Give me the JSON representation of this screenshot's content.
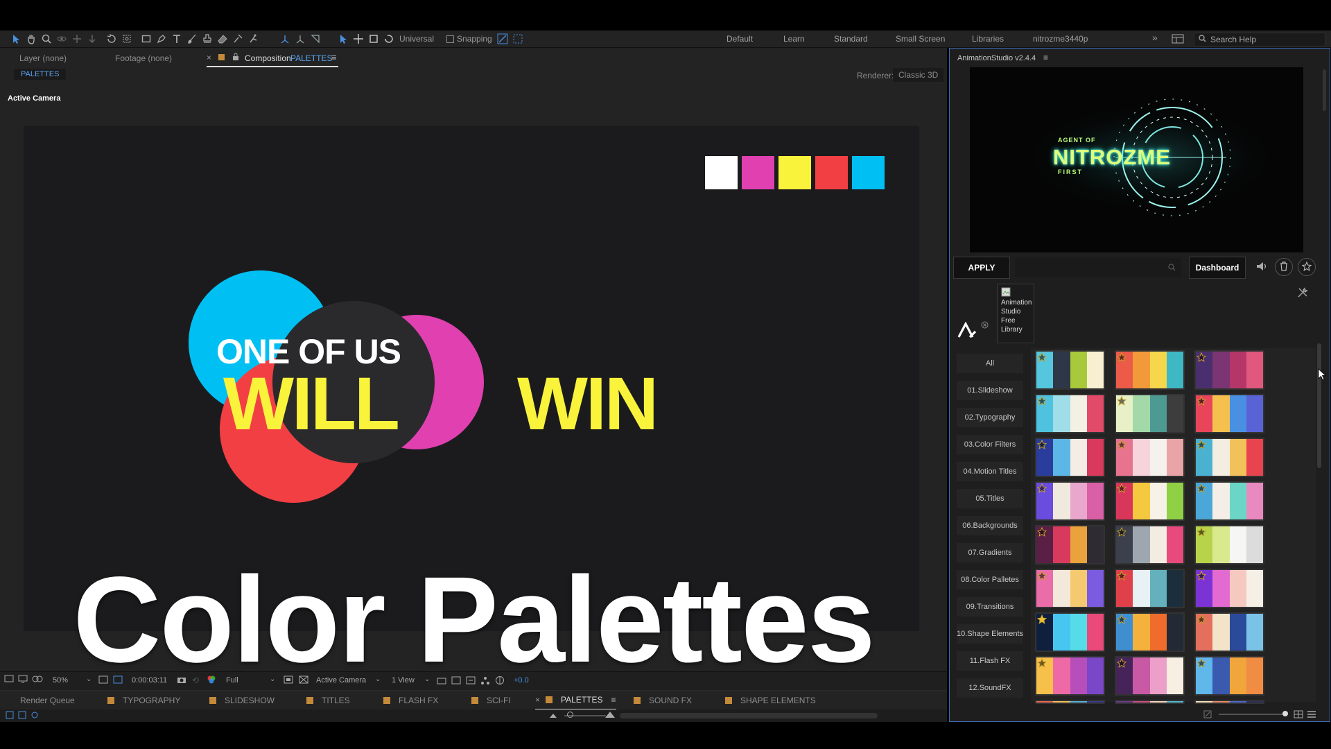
{
  "toolbar": {
    "universal_label": "Universal",
    "snapping_label": "Snapping",
    "workspaces": [
      "Default",
      "Learn",
      "Standard",
      "Small Screen",
      "Libraries",
      "nitrozme3440p"
    ],
    "search_placeholder": "Search Help"
  },
  "comp_panel": {
    "layer_tab": "Layer (none)",
    "footage_tab": "Footage (none)",
    "composition_prefix": "Composition",
    "composition_name": "PALETTES",
    "breadcrumb": "PALETTES",
    "renderer_label": "Renderer:",
    "renderer_value": "Classic 3D",
    "view_label": "Active Camera"
  },
  "artwork": {
    "line1": "ONE OF US",
    "line2a": "WILL",
    "line2b": "WIN",
    "swatches": [
      "#ffffff",
      "#e040b0",
      "#f9f33b",
      "#f23f44",
      "#00bff3"
    ]
  },
  "overlay_title": "Color Palettes",
  "viewer_bar": {
    "zoom": "50%",
    "timecode": "0:00:03:11",
    "resolution": "Full",
    "camera": "Active Camera",
    "views": "1 View",
    "exposure": "+0.0"
  },
  "timeline_tabs": {
    "render_queue": "Render Queue",
    "tabs": [
      "TYPOGRAPHY",
      "SLIDESHOW",
      "TITLES",
      "FLASH FX",
      "SCI-FI",
      "PALETTES",
      "SOUND FX",
      "SHAPE ELEMENTS"
    ]
  },
  "animation_studio": {
    "title": "AnimationStudio v2.4.4",
    "preview_text": "NITROZME",
    "preview_small_top": "AGENT OF",
    "preview_small_bottom": "FIRST",
    "apply_label": "APPLY",
    "dashboard_label": "Dashboard",
    "library_alt": "Animation Studio Free Library",
    "categories": [
      "All",
      "01.Slideshow",
      "02.Typography",
      "03.Color Filters",
      "04.Motion Titles",
      "05.Titles",
      "06.Backgrounds",
      "07.Gradients",
      "08.Color Palletes",
      "09.Transitions",
      "10.Shape Elements",
      "11.Flash FX",
      "12.SoundFX"
    ],
    "palettes": [
      [
        "#55c6de",
        "#2e3747",
        "#a7c93b",
        "#f7efd0"
      ],
      [
        "#ec5a48",
        "#f29a3a",
        "#f6d64a",
        "#3fb8c5"
      ],
      [
        "#4a2f6e",
        "#7a3572",
        "#b5376a",
        "#e0587d"
      ],
      [
        "#4fc2df",
        "#9fdde8",
        "#f3f0e4",
        "#e24a69"
      ],
      [
        "#e7f0c6",
        "#a3d9a9",
        "#4d9a93",
        "#3d3d3d"
      ],
      [
        "#e8455b",
        "#f5c04d",
        "#4a90e2",
        "#5a63d6"
      ],
      [
        "#2a3d9c",
        "#5cb7e6",
        "#f3ede6",
        "#d9395c"
      ],
      [
        "#e8738f",
        "#f7d4dc",
        "#f5f1ec",
        "#e8a4a6"
      ],
      [
        "#4ab1d1",
        "#f3ede2",
        "#f2c25a",
        "#e8444f"
      ],
      [
        "#6a4ddf",
        "#f0e9dd",
        "#e9a7cd",
        "#d95fa6"
      ],
      [
        "#d9365b",
        "#f5c93f",
        "#f7f2e8",
        "#8fd045"
      ],
      [
        "#4aa7d8",
        "#f4eee6",
        "#6cd6c6",
        "#e889c0"
      ],
      [
        "#5b1f45",
        "#d83a5d",
        "#eba23c",
        "#2f2b33"
      ],
      [
        "#3c3f4c",
        "#9ea6b0",
        "#f3ece3",
        "#e84a7d"
      ],
      [
        "#b7d34a",
        "#d9ea8e",
        "#f6f6f2",
        "#dcdcdc"
      ],
      [
        "#ea6ca8",
        "#f3e9da",
        "#f4c96f",
        "#7b5ce0"
      ],
      [
        "#e0404a",
        "#e8f1f4",
        "#64b0bd",
        "#1c2e3b"
      ],
      [
        "#7b33d6",
        "#e36ad0",
        "#f6c9c0",
        "#f5efe6"
      ],
      [
        "#0f1f3d",
        "#48c6f2",
        "#56dbe8",
        "#e94a7a"
      ],
      [
        "#3f8fd0",
        "#f4b23d",
        "#f06c2d",
        "#232a35"
      ],
      [
        "#e46f5c",
        "#f3e3c8",
        "#2a4b9a",
        "#7ac2e6"
      ],
      [
        "#f7c04a",
        "#ee6aa7",
        "#b74fba",
        "#7a47c8"
      ],
      [
        "#46245a",
        "#c85aa5",
        "#ec9fc8",
        "#f7efe1"
      ],
      [
        "#5fb7ea",
        "#3a5ab0",
        "#f0a63b",
        "#f08c43"
      ]
    ],
    "partial_row": [
      [
        "#ec6a5a",
        "#f4c060",
        "#5db0d8",
        "#3b3b8e"
      ],
      [
        "#6b3a8c",
        "#d04f7f",
        "#f6d6c0",
        "#53b9d4"
      ],
      [
        "#f4e0b8",
        "#e98a6a",
        "#4c6bd1",
        "#2d2d5a"
      ]
    ],
    "accent_color": "#3a6ab0"
  }
}
